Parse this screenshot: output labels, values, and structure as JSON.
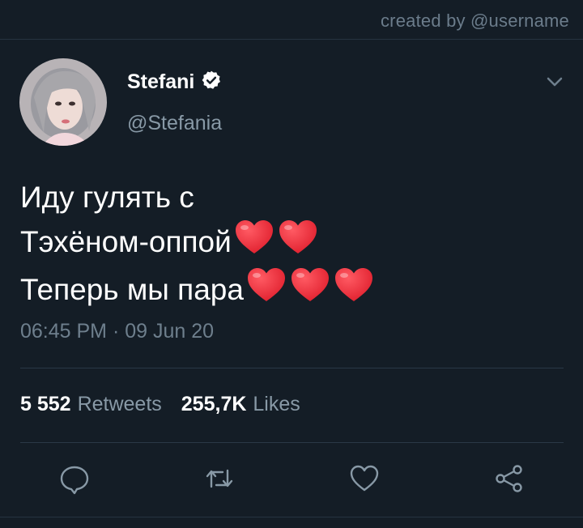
{
  "credit": "created by @username",
  "tweet": {
    "author_name": "Stefani",
    "handle": "@Stefania",
    "lines": [
      {
        "text": "Иду гулять с",
        "hearts": 0
      },
      {
        "text": "Тэхёном-оппой",
        "hearts": 2
      },
      {
        "text": "Теперь мы пара",
        "hearts": 3
      }
    ],
    "timestamp": "06:45 PM · 09 Jun 20"
  },
  "stats": {
    "retweets_count": "5 552",
    "retweets_label": "Retweets",
    "likes_count": "255,7K",
    "likes_label": "Likes"
  },
  "icons": {
    "reply": "reply-icon",
    "retweet": "retweet-icon",
    "like": "like-icon",
    "share": "share-icon",
    "verified": "verified-badge-icon",
    "menu": "chevron-down-icon",
    "heart_emoji": "red-heart-icon"
  },
  "colors": {
    "background": "#141d26",
    "secondary_text": "#8899a6",
    "divider": "#2a3846",
    "heart": "#e0202e"
  }
}
